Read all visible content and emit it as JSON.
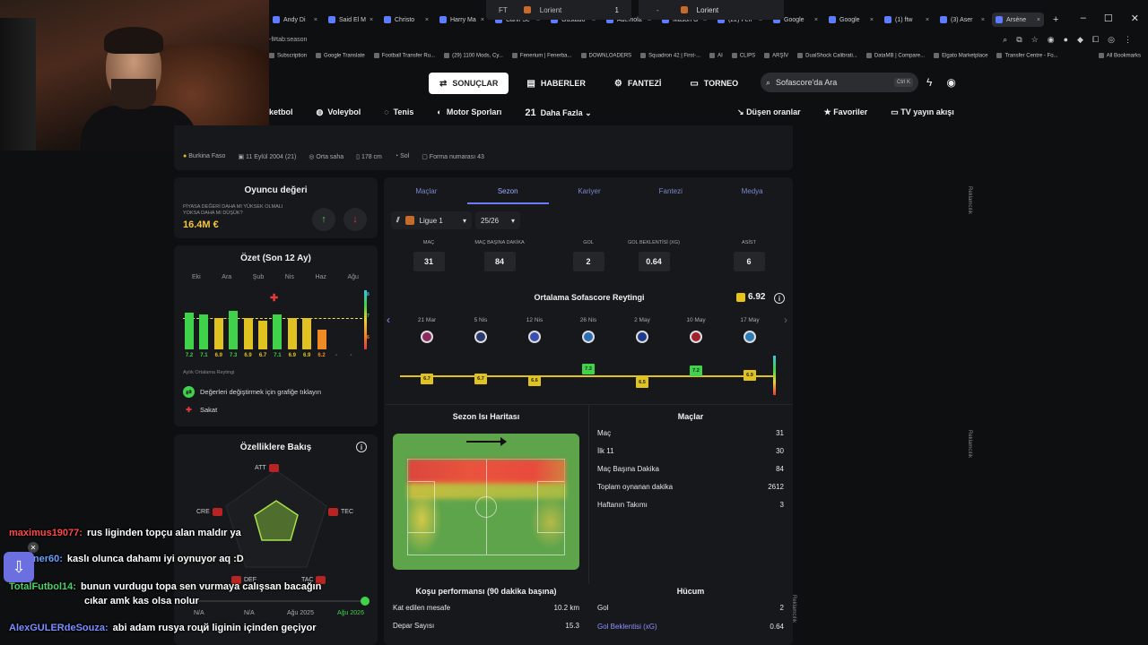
{
  "browser": {
    "tabs": [
      "Andy Di",
      "Said El M",
      "Christo",
      "Harry Ma",
      "Canlı Sc",
      "Gustado",
      "Ademola",
      "Mason G",
      "(22) Fen",
      "Google",
      "Google",
      "(1) ftw",
      "(3) Aser",
      "Arsène"
    ],
    "url": "-f#tab:season",
    "bookmarks": [
      "Subscription",
      "Google Translate",
      "Football Transfer Ru...",
      "(29) 1100 Mods, Cy...",
      "Fenerium | Fenerba...",
      "DOWNLOADERS",
      "Squadron 42 | First-...",
      "AI",
      "CLIPS",
      "ARŞİV",
      "DualShock Calibrati...",
      "DataMB | Compare...",
      "Elgato Marketplace",
      "Transfer Centre - Fo...",
      "All Bookmarks"
    ]
  },
  "header": {
    "nav": [
      {
        "label": "SONUÇLAR",
        "icon": "results-icon",
        "active": true
      },
      {
        "label": "HABERLER",
        "icon": "news-icon",
        "active": false
      },
      {
        "label": "FANTEZİ",
        "icon": "fantasy-icon",
        "active": false
      },
      {
        "label": "TORNEO",
        "icon": "torneo-icon",
        "active": false
      }
    ],
    "search_placeholder": "Sofascore'da Ara",
    "search_shortcut": "Ctrl K",
    "sports": [
      "ketbol",
      "Voleybol",
      "Tenis",
      "Motor Sporları",
      "Daha Fazla"
    ],
    "more_count": "21",
    "right_links": [
      "Düşen oranlar",
      "Favoriler",
      "TV yayın akışı"
    ]
  },
  "profile": {
    "match_status": "FT",
    "team_left": "Lorient",
    "score": "1",
    "dash": "-",
    "team_right": "Lorient",
    "country": "Burkina Faso",
    "birth": "11 Eylül 2004 (21)",
    "position": "Orta saha",
    "height": "178 cm",
    "foot": "Sol",
    "shirt": "Forma numarası 43"
  },
  "player_value": {
    "title": "Oyuncu değeri",
    "question": "PİYASA DEĞERİ DAHA MI YÜKSEK OLMALI YOKSA DAHA MI DÜŞÜK?",
    "value": "16.4M €",
    "up_symbol": "↑",
    "down_symbol": "↓"
  },
  "summary": {
    "title": "Özet (Son 12 Ay)",
    "months": [
      "Eki",
      "Ara",
      "Şub",
      "Nis",
      "Haz",
      "Ağu"
    ],
    "bars": [
      {
        "value": "7.2",
        "rating": 7.2,
        "color": "#3fd24a"
      },
      {
        "value": "7.1",
        "rating": 7.1,
        "color": "#3fd24a"
      },
      {
        "value": "6.9",
        "rating": 6.9,
        "color": "#e0c320"
      },
      {
        "value": "7.3",
        "rating": 7.3,
        "color": "#3fd24a"
      },
      {
        "value": "6.9",
        "rating": 6.9,
        "color": "#e0c320"
      },
      {
        "value": "6.7",
        "rating": 6.7,
        "color": "#e0c320"
      },
      {
        "value": "7.1",
        "rating": 7.1,
        "color": "#3fd24a"
      },
      {
        "value": "6.9",
        "rating": 6.9,
        "color": "#e0c320"
      },
      {
        "value": "6.9",
        "rating": 6.9,
        "color": "#e0c320"
      },
      {
        "value": "6.2",
        "rating": 6.2,
        "color": "#f08a24"
      },
      {
        "value": "-",
        "rating": 0,
        "color": "#555"
      },
      {
        "value": "-",
        "rating": 0,
        "color": "#555"
      }
    ],
    "scale": [
      "8",
      "7",
      "6"
    ],
    "subtitle": "Aylık Ortalama Reytingi",
    "hint": "Değerleri değiştirmek için grafiğe tıklayın",
    "injured": "Sakat"
  },
  "attributes": {
    "title": "Özelliklere Bakış",
    "labels": [
      "ATT",
      "TEC",
      "TAC",
      "DEF",
      "CRE"
    ]
  },
  "timeline": {
    "labels": [
      "N/A",
      "N/A",
      "Ağu 2025",
      "Ağu 2026"
    ]
  },
  "main": {
    "tabs": [
      "Maçlar",
      "Sezon",
      "Kariyer",
      "Fantezi",
      "Medya"
    ],
    "league": "Ligue 1",
    "season": "25/26",
    "stats": [
      {
        "label": "MAÇ",
        "value": "31"
      },
      {
        "label": "MAÇ BAŞINA DAKİKA",
        "value": "84"
      },
      {
        "label": "GOL",
        "value": "2"
      },
      {
        "label": "GOL BEKLENTİSİ (XG)",
        "value": "0.64"
      },
      {
        "label": "ASİST",
        "value": "6"
      }
    ],
    "rating_title": "Ortalama Sofascore Reytingi",
    "rating_value": "6.92",
    "dates": [
      "21 Mar",
      "5 Nis",
      "12 Nis",
      "26 Nis",
      "2 May",
      "10 May",
      "17 May"
    ],
    "crest_colors": [
      "#8a2a5e",
      "#2b3a72",
      "#3a4fb0",
      "#2a6fb0",
      "#1d3c8c",
      "#a3202e",
      "#2d7bb5"
    ],
    "match_ratings": [
      {
        "value": "6.7",
        "rating": 6.7,
        "color": "#e0c320"
      },
      {
        "value": "6.7",
        "rating": 6.7,
        "color": "#e0c320"
      },
      {
        "value": "6.6",
        "rating": 6.6,
        "color": "#e0c320"
      },
      {
        "value": "7.3",
        "rating": 7.3,
        "color": "#3fd24a"
      },
      {
        "value": "6.5",
        "rating": 6.5,
        "color": "#e0c320"
      },
      {
        "value": "7.2",
        "rating": 7.2,
        "color": "#3fd24a"
      },
      {
        "value": "6.9",
        "rating": 6.9,
        "color": "#e0c320"
      }
    ],
    "heatmap_title": "Sezon Isı Haritası",
    "matches_title": "Maçlar",
    "matches_rows": [
      {
        "label": "Maç",
        "value": "31"
      },
      {
        "label": "İlk 11",
        "value": "30"
      },
      {
        "label": "Maç Başına Dakika",
        "value": "84"
      },
      {
        "label": "Toplam oynanan dakika",
        "value": "2612"
      },
      {
        "label": "Haftanın Takımı",
        "value": "3"
      }
    ],
    "running_title": "Koşu performansı (90 dakika başına)",
    "running_rows": [
      {
        "label": "Kat edilen mesafe",
        "value": "10.2 km"
      },
      {
        "label": "Depar Sayısı",
        "value": "15.3"
      }
    ],
    "attack_title": "Hücum",
    "attack_rows": [
      {
        "label": "Gol",
        "value": "2"
      },
      {
        "label": "Gol Beklentisi (xG)",
        "value": "0.64"
      }
    ]
  },
  "chat": [
    {
      "user": "maximus19077:",
      "msg": "rus liginden topçu alan maldır ya"
    },
    {
      "user": "prisoner60:",
      "msg": "kaslı olunca dahamı iyi oynuyor aq :D"
    },
    {
      "user": "TotalFutbol14:",
      "msg": "bunun vurdugu topa sen vurmaya calışsan bacağın"
    },
    {
      "user": "",
      "msg": "cıkar amk kas olsa nolur"
    },
    {
      "user": "AlexGULERdeSouza:",
      "msg": "abi adam rusya roцй liginin içinden geçiyor"
    }
  ],
  "ads_label": "Reklamcılık"
}
